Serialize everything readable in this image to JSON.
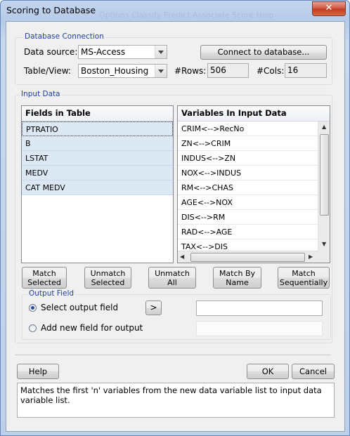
{
  "window": {
    "title": "Scoring to Database",
    "close_label": "✕",
    "ghost_menu": "Options Classify Predict Associate Score Help"
  },
  "db_connection": {
    "legend": "Database Connection",
    "data_source_label": "Data source:",
    "data_source_value": "MS-Access",
    "connect_button": "Connect to database...",
    "table_label": "Table/View:",
    "table_value": "Boston_Housing",
    "rows_label": "#Rows:",
    "rows_value": "506",
    "cols_label": "#Cols:",
    "cols_value": "16"
  },
  "input_data": {
    "legend": "Input Data",
    "fields_header": "Fields in Table",
    "fields": [
      "PTRATIO",
      "B",
      "LSTAT",
      "MEDV",
      "CAT MEDV"
    ],
    "vars_header": "Variables In Input Data",
    "variables": [
      "CRIM<-->RecNo",
      "ZN<-->CRIM",
      "INDUS<-->ZN",
      "NOX<-->INDUS",
      "RM<-->CHAS",
      "AGE<-->NOX",
      "DIS<-->RM",
      "RAD<-->AGE",
      "TAX<-->DIS"
    ]
  },
  "match_buttons": {
    "match_selected_1": "Match",
    "match_selected_2": "Selected",
    "unmatch_selected_1": "Unmatch",
    "unmatch_selected_2": "Selected",
    "unmatch_all_1": "Unmatch",
    "unmatch_all_2": "All",
    "match_by_name_1": "Match By",
    "match_by_name_2": "Name",
    "match_seq_1": "Match",
    "match_seq_2": "Sequentially"
  },
  "output_field": {
    "legend": "Output Field",
    "select_label": "Select output field",
    "select_button": ">",
    "add_label": "Add new field for output"
  },
  "footer": {
    "help": "Help",
    "ok": "OK",
    "cancel": "Cancel",
    "status": "Matches the first 'n' variables from the new data variable list to input data variable list."
  }
}
